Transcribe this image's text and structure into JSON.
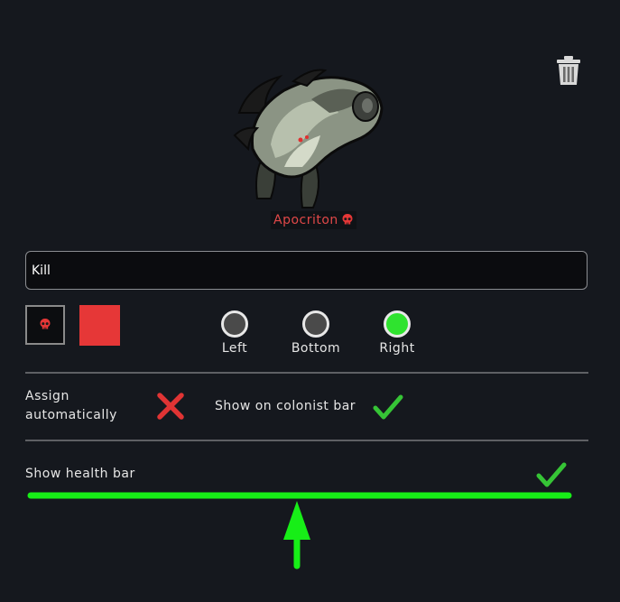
{
  "pawn": {
    "name": "Apocriton",
    "name_color": "#e04848"
  },
  "toolbar": {
    "delete_icon": "trash-icon"
  },
  "name_field": {
    "value": "Kill"
  },
  "marker": {
    "icon": "skull-icon",
    "icon_color": "#e63737",
    "color": "#e63737"
  },
  "position": {
    "options": [
      {
        "label": "Left",
        "selected": false
      },
      {
        "label": "Bottom",
        "selected": false
      },
      {
        "label": "Right",
        "selected": true
      }
    ],
    "selected_color": "#2fe32f"
  },
  "settings": {
    "assign_automatically": {
      "label": "Assign automatically",
      "line1": "Assign",
      "line2": "automatically",
      "value": false
    },
    "show_on_colonist_bar": {
      "label": "Show on colonist bar",
      "value": true
    },
    "show_health_bar": {
      "label": "Show health bar",
      "value": true
    }
  },
  "annotation": {
    "color": "#17ee17",
    "shape": "underline-with-up-arrow"
  }
}
